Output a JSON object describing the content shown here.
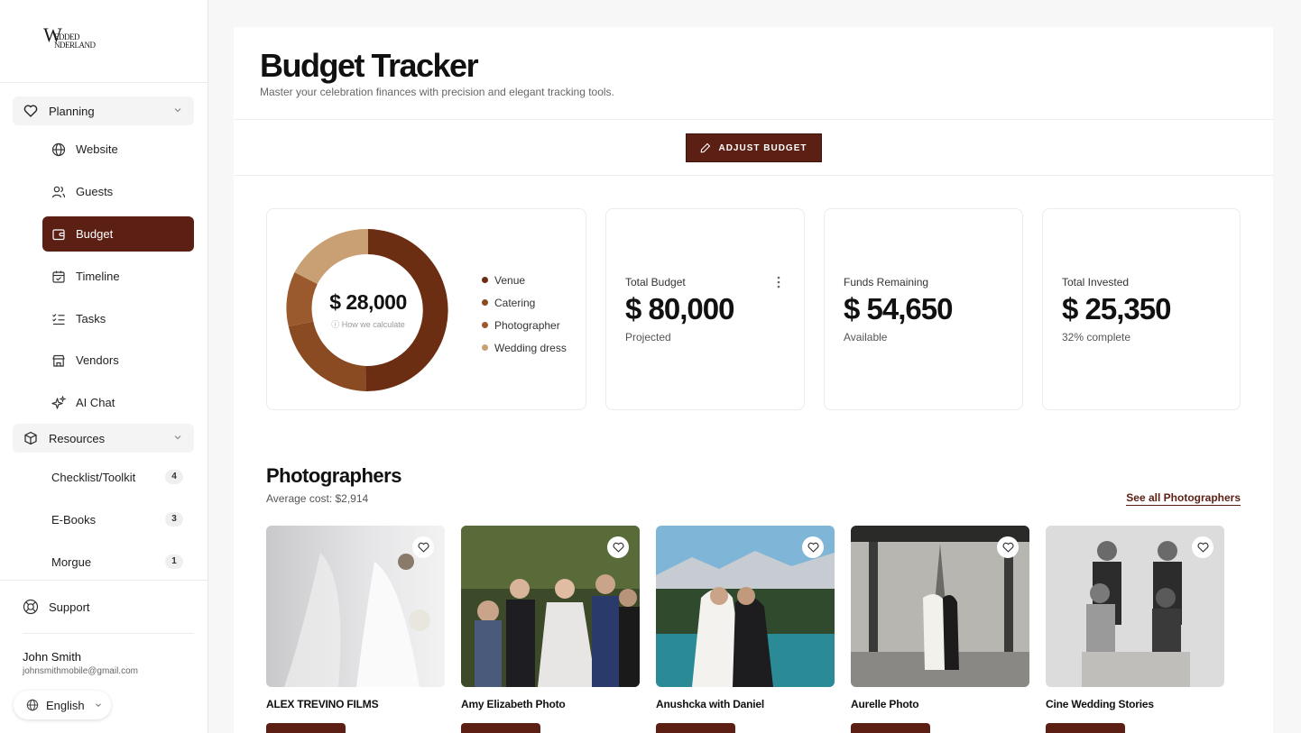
{
  "brand": {
    "logo_letter": "W",
    "logo_line1": "EDDED",
    "logo_line2": "NDERLAND"
  },
  "sidebar": {
    "planning": {
      "label": "Planning",
      "items": [
        {
          "label": "Website",
          "icon": "globe-icon"
        },
        {
          "label": "Guests",
          "icon": "users-icon"
        },
        {
          "label": "Budget",
          "icon": "wallet-icon",
          "active": true
        },
        {
          "label": "Timeline",
          "icon": "calendar-icon"
        },
        {
          "label": "Tasks",
          "icon": "checklist-icon"
        },
        {
          "label": "Vendors",
          "icon": "store-icon"
        },
        {
          "label": "AI Chat",
          "icon": "sparkles-icon"
        }
      ]
    },
    "resources": {
      "label": "Resources",
      "items": [
        {
          "label": "Checklist/Toolkit",
          "count": "4"
        },
        {
          "label": "E-Books",
          "count": "3"
        },
        {
          "label": "Morgue",
          "count": "1"
        }
      ]
    },
    "support_label": "Support",
    "user": {
      "name": "John Smith",
      "email": "johnsmithmobile@gmail.com"
    },
    "language": "English"
  },
  "header": {
    "title": "Budget Tracker",
    "subtitle": "Master your celebration finances with precision and elegant tracking tools.",
    "adjust_button": "ADJUST BUDGET"
  },
  "donut": {
    "total": "$ 28,000",
    "caption": "How we calculate",
    "legend": [
      {
        "label": "Venue",
        "color": "#6b2e12"
      },
      {
        "label": "Catering",
        "color": "#8a4a22"
      },
      {
        "label": "Photographer",
        "color": "#9a5a2e"
      },
      {
        "label": "Wedding dress",
        "color": "#c9a073"
      }
    ]
  },
  "stats": [
    {
      "label": "Total Budget",
      "value": "$ 80,000",
      "sub": "Projected"
    },
    {
      "label": "Funds Remaining",
      "value": "$ 54,650",
      "sub": "Available"
    },
    {
      "label": "Total Invested",
      "value": "$ 25,350",
      "sub": "32% complete"
    }
  ],
  "photographers": {
    "title": "Photographers",
    "average": "Average cost: $2,914",
    "see_all": "See all Photographers",
    "vendors": [
      {
        "name": "ALEX TREVINO FILMS"
      },
      {
        "name": "Amy Elizabeth Photo"
      },
      {
        "name": "Anushcka with Daniel"
      },
      {
        "name": "Aurelle Photo"
      },
      {
        "name": "Cine Wedding Stories"
      }
    ]
  },
  "colors": {
    "accent": "#5c1f14"
  }
}
